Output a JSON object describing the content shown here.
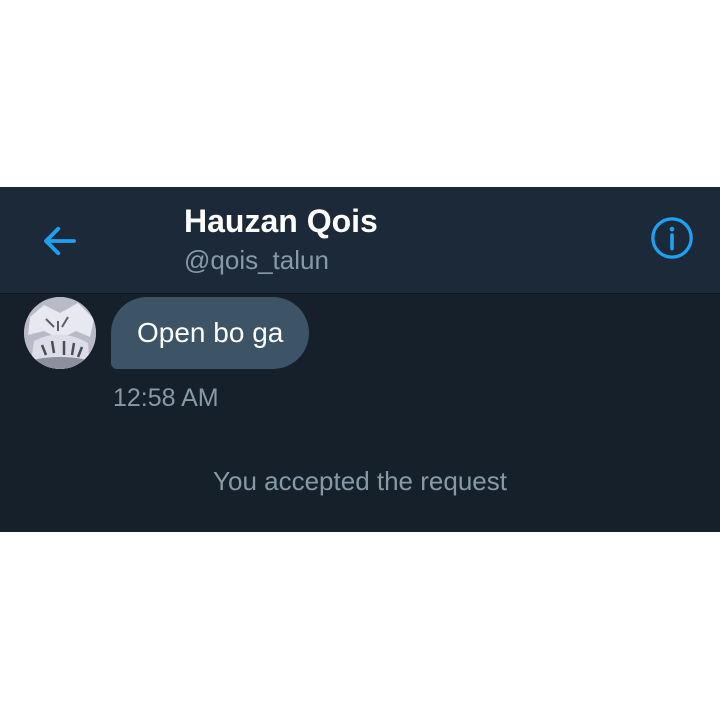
{
  "header": {
    "name": "Hauzan Qois",
    "handle": "@qois_talun",
    "back_icon": "arrow-left-icon",
    "info_icon": "info-circle-icon",
    "accent_color": "#1da1f2"
  },
  "conversation": {
    "messages": [
      {
        "text": "Open bo ga",
        "time": "12:58 AM",
        "direction": "incoming"
      }
    ],
    "system_message": "You accepted the request"
  },
  "colors": {
    "background": "#15202b",
    "header_background": "#1c2938",
    "bubble": "#3d5466",
    "secondary_text": "#8899a6"
  }
}
